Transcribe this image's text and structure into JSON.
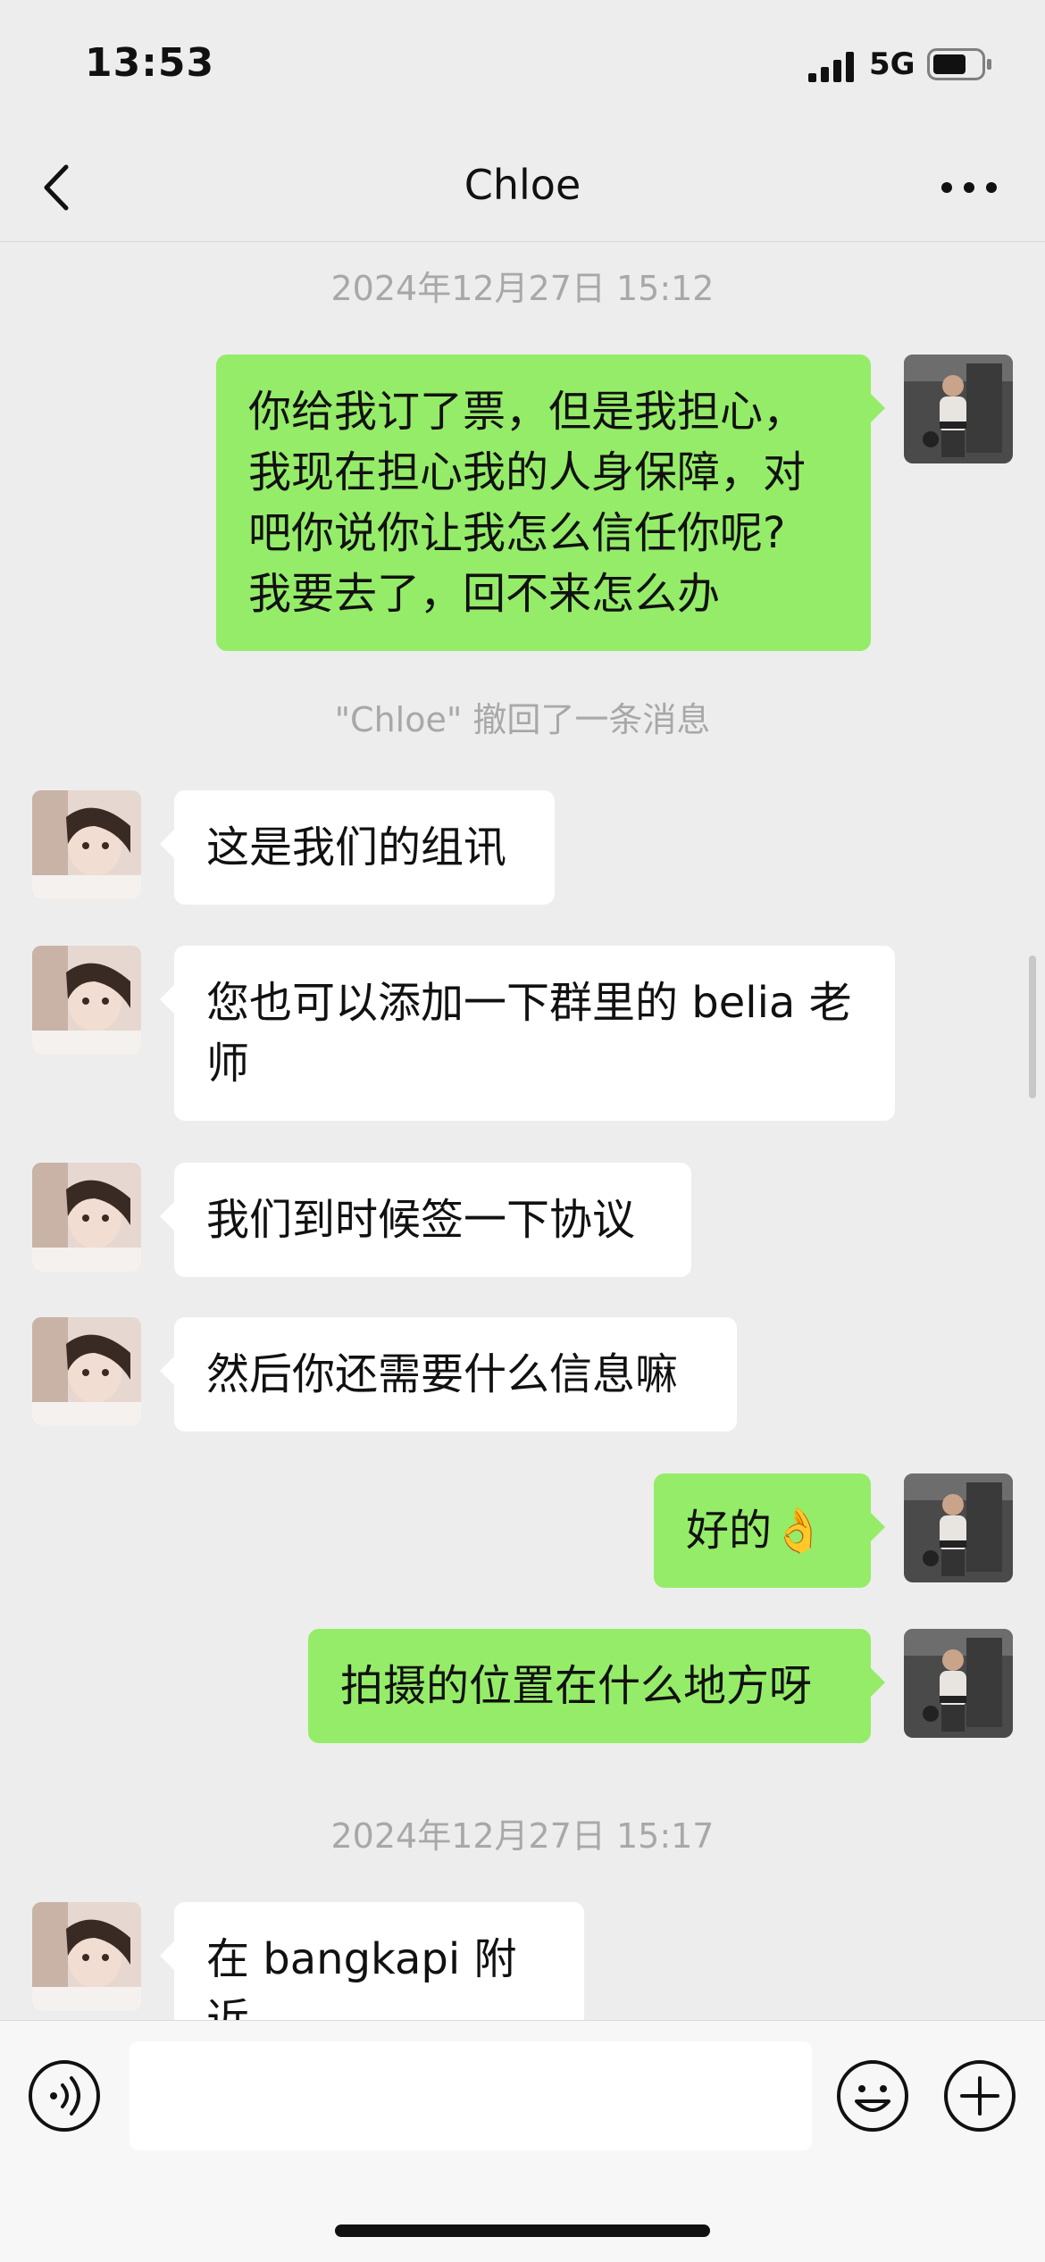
{
  "status_bar": {
    "time": "13:53",
    "network": "5G"
  },
  "header": {
    "title": "Chloe"
  },
  "timestamps": [
    "2024年12月27日 15:12",
    "2024年12月27日 15:17"
  ],
  "recall_notice": "\"Chloe\" 撤回了一条消息",
  "messages": [
    {
      "sender": "me",
      "text": "你给我订了票，但是我担心，\n我现在担心我的人身保障，对\n吧你说你让我怎么信任你呢?\n我要去了，回不来怎么办"
    },
    {
      "sender": "Chloe",
      "text": "这是我们的组讯"
    },
    {
      "sender": "Chloe",
      "text": "您也可以添加一下群里的 belia 老\n师"
    },
    {
      "sender": "Chloe",
      "text": "我们到时候签一下协议"
    },
    {
      "sender": "Chloe",
      "text": "然后你还需要什么信息嘛"
    },
    {
      "sender": "me",
      "text": "好的👌"
    },
    {
      "sender": "me",
      "text": "拍摄的位置在什么地方呀"
    },
    {
      "sender": "Chloe",
      "text": "在 bangkapi 附近"
    }
  ],
  "input": {
    "value": ""
  },
  "icons": [
    "back-chevron",
    "more-dots",
    "voice",
    "emoji",
    "plus"
  ],
  "colors": {
    "background": "#ededed",
    "outgoing_bubble": "#95ec69",
    "incoming_bubble": "#ffffff",
    "meta_text": "#a8a8a8"
  }
}
